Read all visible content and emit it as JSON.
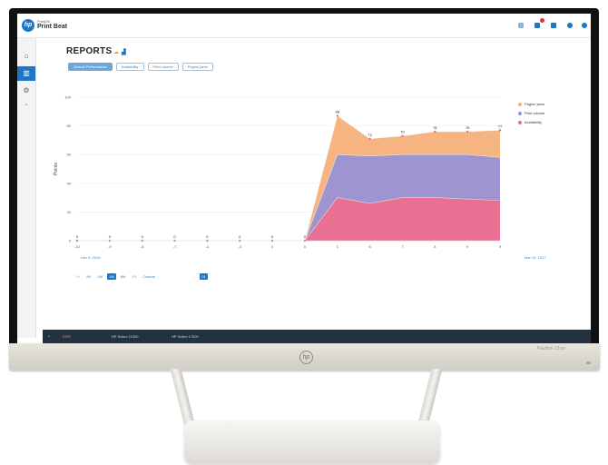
{
  "app": {
    "brand_sub": "PrintOS",
    "brand": "Print Beat"
  },
  "page": {
    "title": "REPORTS"
  },
  "chips": [
    "Overall Performance",
    "Availability",
    "Print volume",
    "Pages/ jams"
  ],
  "date_range": {
    "start": "Dec 5, 2016",
    "end": "Mar 12, 2017"
  },
  "range_buttons": [
    "1H",
    "2H",
    "1W",
    "1M",
    "6M",
    "1Y",
    "Custom"
  ],
  "range_selected": "1M",
  "pager": {
    "prev": "‹",
    "current": "01",
    "next": "›"
  },
  "footer": {
    "toggle": "^",
    "label": "SITE",
    "tabs": [
      "HP Scitex 11000",
      "HP Scitex 17000"
    ]
  },
  "monitor": {
    "model": "Pavilion 22cw",
    "logo": "hp"
  },
  "colors": {
    "accent": "#1f75c6",
    "availability": "#ec6e8f",
    "print_volume": "#9892d4",
    "pages_jams": "#f5b07a"
  },
  "chart_data": {
    "type": "area",
    "stacked": true,
    "ylabel": "Points",
    "xlabel": "",
    "ylim": [
      0,
      100
    ],
    "yticks": [
      0,
      20,
      40,
      60,
      80,
      100
    ],
    "x": [
      "-10",
      "-9",
      "-8",
      "-7",
      "-6",
      "-5",
      "-4",
      "-3",
      "-2",
      "-1",
      "0",
      "1",
      "2",
      "3"
    ],
    "x_labels_visible": [
      "-10",
      "-9",
      "-8",
      "-7",
      "-4",
      "-3",
      "0",
      "0",
      "1",
      "6",
      "7",
      "8",
      "9",
      "9"
    ],
    "series": [
      {
        "name": "Availability",
        "color": "#ec6e8f",
        "values": [
          0,
          0,
          0,
          0,
          0,
          0,
          0,
          0,
          30,
          26,
          30,
          30,
          29,
          28
        ]
      },
      {
        "name": "Print volume",
        "color": "#9892d4",
        "values": [
          0,
          0,
          0,
          0,
          0,
          0,
          0,
          0,
          30,
          33,
          30,
          30,
          31,
          30
        ]
      },
      {
        "name": "Pages/ jams",
        "color": "#f5b07a",
        "values": [
          0,
          0,
          0,
          0,
          0,
          0,
          0,
          0,
          27,
          12,
          13,
          16,
          16,
          19
        ]
      }
    ],
    "point_labels": [
      "0",
      "0",
      "0",
      "0",
      "0",
      "0",
      "0",
      "0",
      "88",
      "72",
      "70",
      "76",
      "76",
      "77"
    ],
    "legend": [
      "Pages/ jams",
      "Print volume",
      "Availability"
    ],
    "legend_position": "right",
    "grid": true
  }
}
